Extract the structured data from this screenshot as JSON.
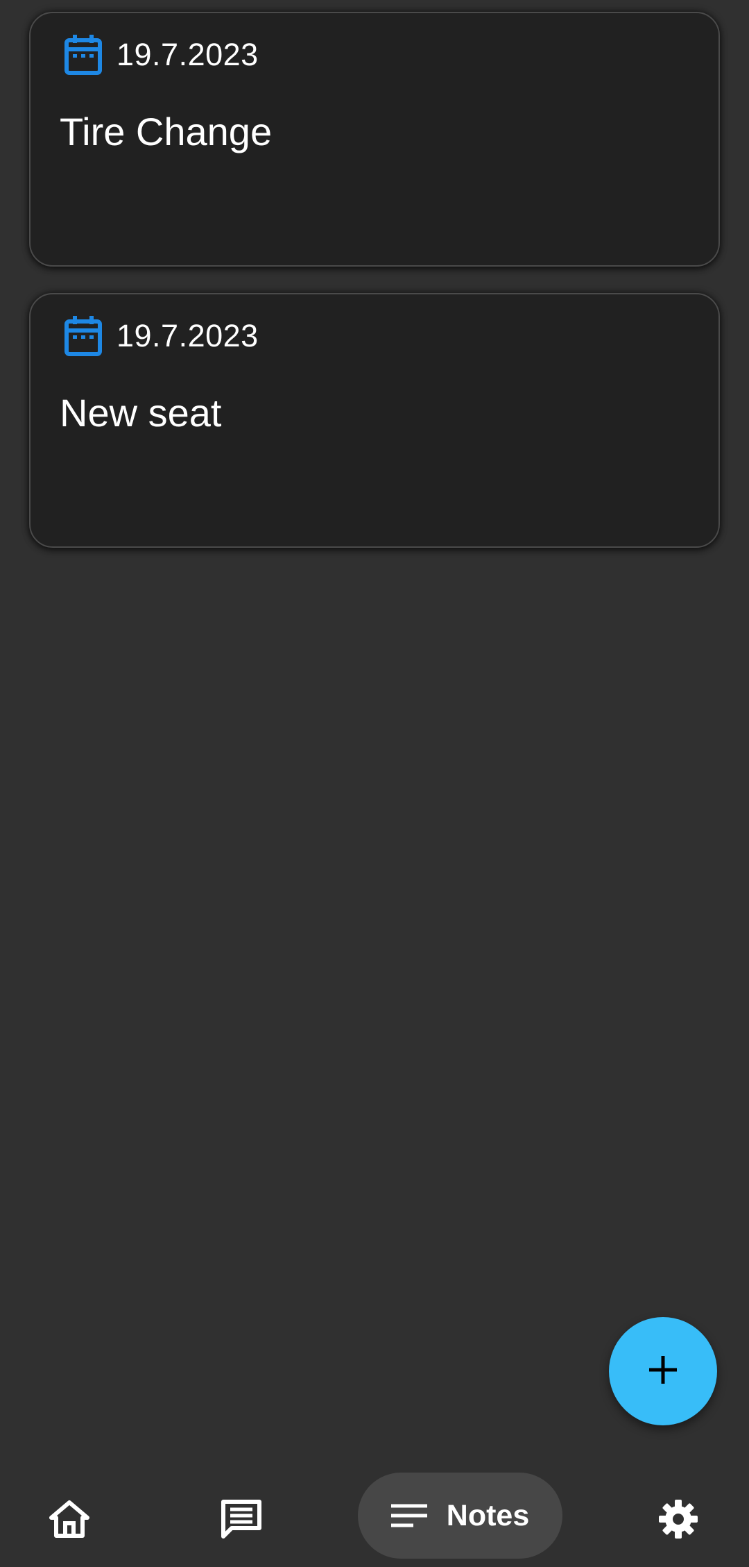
{
  "notes": [
    {
      "date": "19.7.2023",
      "title": "Tire Change"
    },
    {
      "date": "19.7.2023",
      "title": "New seat"
    }
  ],
  "fab": {
    "icon": "plus-icon",
    "color": "#38bdf8"
  },
  "bottom_nav": {
    "items": [
      {
        "icon": "home-icon",
        "label": ""
      },
      {
        "icon": "chat-icon",
        "label": ""
      },
      {
        "icon": "notes-icon",
        "label": "Notes",
        "selected": true
      },
      {
        "icon": "gear-icon",
        "label": ""
      }
    ]
  },
  "colors": {
    "background": "#303030",
    "card": "#212121",
    "accent_icon": "#1e88e5",
    "nav_selected": "#474747"
  }
}
